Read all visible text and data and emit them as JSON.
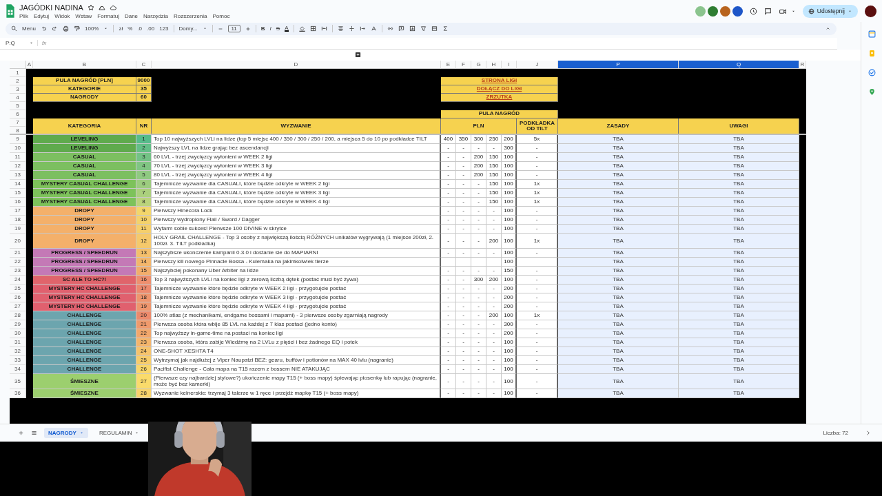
{
  "header": {
    "title": "JAGÓDKI NADINA",
    "menus": [
      "Plik",
      "Edytuj",
      "Widok",
      "Wstaw",
      "Formatuj",
      "Dane",
      "Narzędzia",
      "Rozszerzenia",
      "Pomoc"
    ],
    "share_button": "Udostępnij"
  },
  "collaborators": [
    {
      "color": "#8bc48e"
    },
    {
      "color": "#2e7d32"
    },
    {
      "color": "#b8641e"
    },
    {
      "color": "#1e56c8"
    }
  ],
  "toolbar": {
    "menu": "Menu",
    "zoom": "100%",
    "currency": "zł",
    "percent": "%",
    "decimal_decrease": ".0",
    "decimal_increase": ".00",
    "number_format": "123",
    "font": "Domy...",
    "font_size": "11",
    "bold": "B",
    "italic": "I",
    "strikethrough": "S",
    "text_color": "A"
  },
  "formula_bar": {
    "name_box": "P:Q",
    "fx": "fx"
  },
  "columns": [
    {
      "letter": "A",
      "selected": false
    },
    {
      "letter": "B",
      "selected": false
    },
    {
      "letter": "C",
      "selected": false
    },
    {
      "letter": "D",
      "selected": false
    },
    {
      "letter": "E",
      "selected": false
    },
    {
      "letter": "F",
      "selected": false
    },
    {
      "letter": "G",
      "selected": false
    },
    {
      "letter": "H",
      "selected": false
    },
    {
      "letter": "I",
      "selected": false
    },
    {
      "letter": "J",
      "selected": false
    },
    {
      "letter": "P",
      "selected": true
    },
    {
      "letter": "Q",
      "selected": true
    },
    {
      "letter": "R",
      "selected": false
    }
  ],
  "top_row_numbers": [
    "1",
    "2",
    "3",
    "4",
    "5",
    "6",
    "7",
    "8"
  ],
  "summary": [
    {
      "label": "PULA NAGRÓD [PLN]",
      "value": "9000"
    },
    {
      "label": "KATEGORIE",
      "value": "35"
    },
    {
      "label": "NAGRODY",
      "value": "60"
    }
  ],
  "links": [
    "STRONA LIGI",
    "DOŁĄCZ DO LIGI",
    "ZRZUTKA"
  ],
  "prize_pool": "PULA NAGRÓD",
  "headers": {
    "category": "KATEGORIA",
    "nr": "NR",
    "challenge": "WYZWANIE",
    "pln": "PLN",
    "tilt": "PODKŁADKA OD TILT",
    "rules": "ZASADY",
    "notes": "UWAGI"
  },
  "rows": [
    {
      "row": "9",
      "category": {
        "label": "LEVELING",
        "color": "#5faa4d"
      },
      "nr": {
        "label": "1",
        "color": "#57bb8a"
      },
      "challenge": "Top 10 najwyższych LVLi na lidze (top 5 miejsc 400 / 350 / 300 / 250 / 200, a miejsca 5 do 10 po podkładce TILT",
      "prizes": {
        "E": "400",
        "F": "350",
        "G": "300",
        "H": "250",
        "I": "200"
      },
      "tilt": "5x",
      "rules": "TBA",
      "notes": "TBA"
    },
    {
      "row": "10",
      "category": {
        "label": "LEVELING",
        "color": "#5faa4d"
      },
      "nr": {
        "label": "2",
        "color": "#63be87"
      },
      "challenge": "Najwyższy LVL na lidze grając bez ascendancji",
      "prizes": {
        "E": "-",
        "F": "-",
        "G": "-",
        "H": "-",
        "I": "300"
      },
      "tilt": "-",
      "rules": "TBA",
      "notes": "TBA"
    },
    {
      "row": "11",
      "category": {
        "label": "CASUAL",
        "color": "#7cbf60"
      },
      "nr": {
        "label": "3",
        "color": "#73c285"
      },
      "challenge": "60 LVL - trzej zwycięzcy wyłonieni w WEEK 2 ligi",
      "prizes": {
        "E": "-",
        "F": "-",
        "G": "200",
        "H": "150",
        "I": "100"
      },
      "tilt": "-",
      "rules": "TBA",
      "notes": "TBA"
    },
    {
      "row": "12",
      "category": {
        "label": "CASUAL",
        "color": "#7cbf60"
      },
      "nr": {
        "label": "4",
        "color": "#80c583"
      },
      "challenge": "70 LVL - trzej zwycięzcy wyłonieni w WEEK 3 ligi",
      "prizes": {
        "E": "-",
        "F": "-",
        "G": "200",
        "H": "150",
        "I": "100"
      },
      "tilt": "-",
      "rules": "TBA",
      "notes": "TBA"
    },
    {
      "row": "13",
      "category": {
        "label": "CASUAL",
        "color": "#7cbf60"
      },
      "nr": {
        "label": "5",
        "color": "#8fc981"
      },
      "challenge": "80 LVL - trzej zwycięzcy wyłonieni w WEEK 4 ligi",
      "prizes": {
        "E": "-",
        "F": "-",
        "G": "200",
        "H": "150",
        "I": "100"
      },
      "tilt": "-",
      "rules": "TBA",
      "notes": "TBA"
    },
    {
      "row": "14",
      "category": {
        "label": "MYSTERY CASUAL CHALLENGE",
        "color": "#7dc25a"
      },
      "nr": {
        "label": "6",
        "color": "#9ccc7f"
      },
      "challenge": "Tajemnicze wyzwanie dla CASUALI, które będzie odkryte w WEEK 2 ligi",
      "prizes": {
        "E": "-",
        "F": "-",
        "G": "-",
        "H": "150",
        "I": "100"
      },
      "tilt": "1x",
      "rules": "TBA",
      "notes": "TBA"
    },
    {
      "row": "15",
      "category": {
        "label": "MYSTERY CASUAL CHALLENGE",
        "color": "#7dc25a"
      },
      "nr": {
        "label": "7",
        "color": "#abd07d"
      },
      "challenge": "Tajemnicze wyzwanie dla CASUALI, które będzie odkryte w WEEK 3 ligi",
      "prizes": {
        "E": "-",
        "F": "-",
        "G": "-",
        "H": "150",
        "I": "100"
      },
      "tilt": "1x",
      "rules": "TBA",
      "notes": "TBA"
    },
    {
      "row": "16",
      "category": {
        "label": "MYSTERY CASUAL CHALLENGE",
        "color": "#7dc25a"
      },
      "nr": {
        "label": "8",
        "color": "#bad37b"
      },
      "challenge": "Tajemnicze wyzwanie dla CASUALI, które będzie odkryte w WEEK 4 ligi",
      "prizes": {
        "E": "-",
        "F": "-",
        "G": "-",
        "H": "150",
        "I": "100"
      },
      "tilt": "1x",
      "rules": "TBA",
      "notes": "TBA"
    },
    {
      "row": "17",
      "category": {
        "label": "DROPY",
        "color": "#f4b06a"
      },
      "nr": {
        "label": "9",
        "color": "#f3d66b"
      },
      "challenge": "Pierwszy Hinecora Lock",
      "prizes": {
        "E": "-",
        "F": "-",
        "G": "-",
        "H": "-",
        "I": "100"
      },
      "tilt": "-",
      "rules": "TBA",
      "notes": "TBA"
    },
    {
      "row": "18",
      "category": {
        "label": "DROPY",
        "color": "#f4b06a"
      },
      "nr": {
        "label": "10",
        "color": "#f4d26b"
      },
      "challenge": "Pierwszy wydropiony Flail / Sword / Dagger",
      "prizes": {
        "E": "-",
        "F": "-",
        "G": "-",
        "H": "-",
        "I": "100"
      },
      "tilt": "-",
      "rules": "TBA",
      "notes": "TBA"
    },
    {
      "row": "19",
      "category": {
        "label": "DROPY",
        "color": "#f4b06a"
      },
      "nr": {
        "label": "11",
        "color": "#f5cf6b"
      },
      "challenge": "Wyfarm sobie sukces! Pierwsze 100 DIVINE w skrytce",
      "prizes": {
        "E": "-",
        "F": "-",
        "G": "-",
        "H": "-",
        "I": "100"
      },
      "tilt": "-",
      "rules": "TBA",
      "notes": "TBA"
    },
    {
      "row": "20",
      "category": {
        "label": "DROPY",
        "color": "#f4b06a"
      },
      "nr": {
        "label": "12",
        "color": "#f5c96b"
      },
      "challenge": "HOLY GRAIL CHALLENGE - Top 3 osoby z największą ilością RÓŻNYCH unikatów wygrywają (1 miejsce 200zł, 2. 100zł. 3. TILT podkładka)",
      "prizes": {
        "E": "-",
        "F": "-",
        "G": "-",
        "H": "200",
        "I": "100"
      },
      "tilt": "1x",
      "rules": "TBA",
      "notes": "TBA"
    },
    {
      "row": "21",
      "category": {
        "label": "PROGRESS / SPEEDRUN",
        "color": "#c479b6"
      },
      "nr": {
        "label": "13",
        "color": "#f4bf6b"
      },
      "challenge": "Najszybsze ukonczenie kampanii 0.3.0 i dostanie sie do MAPIARNI",
      "prizes": {
        "E": "-",
        "F": "-",
        "G": "-",
        "H": "-",
        "I": "100"
      },
      "tilt": "-",
      "rules": "TBA",
      "notes": "TBA"
    },
    {
      "row": "22",
      "category": {
        "label": "PROGRESS / SPEEDRUN",
        "color": "#c479b6"
      },
      "nr": {
        "label": "14",
        "color": "#f3b66b"
      },
      "challenge": "Pierwszy kill nowego Pinnacle Bossa - Kulemaka na jakimkolwiek tierze",
      "prizes": {
        "I": "100"
      },
      "rules": "TBA",
      "notes": "TBA"
    },
    {
      "row": "23",
      "category": {
        "label": "PROGRESS / SPEEDRUN",
        "color": "#c479b6"
      },
      "nr": {
        "label": "15",
        "color": "#f2ad6b"
      },
      "challenge": "Najszybciej pokonany Uber Arbiter na lidze",
      "prizes": {
        "E": "-",
        "F": "-",
        "G": "-",
        "H": "-",
        "I": "150"
      },
      "tilt": "-",
      "rules": "TBA",
      "notes": "TBA"
    },
    {
      "row": "24",
      "category": {
        "label": "SC ALE TO HC?!",
        "color": "#e0646b"
      },
      "nr": {
        "label": "16",
        "color": "#ee8f6e"
      },
      "challenge": "Top 3 najwyższych LVLi na koniec ligi z zerową liczbą dętek (postać musi być żywa)",
      "prizes": {
        "E": "-",
        "F": "-",
        "G": "300",
        "H": "200",
        "I": "100"
      },
      "tilt": "-",
      "rules": "TBA",
      "notes": "TBA"
    },
    {
      "row": "25",
      "category": {
        "label": "MYSTERY HC CHALLENGE",
        "color": "#e0606e"
      },
      "nr": {
        "label": "17",
        "color": "#ed8a6e"
      },
      "challenge": "Tajemnicze wyzwanie które będzie odkryte w WEEK 2 ligi - przygotujcie postać",
      "prizes": {
        "E": "-",
        "F": "-",
        "G": "-",
        "H": "-",
        "I": "200"
      },
      "tilt": "-",
      "rules": "TBA",
      "notes": "TBA"
    },
    {
      "row": "26",
      "category": {
        "label": "MYSTERY HC CHALLENGE",
        "color": "#e0606e"
      },
      "nr": {
        "label": "18",
        "color": "#ef956d"
      },
      "challenge": "Tajemnicze wyzwanie które będzie odkryte w WEEK 3 ligi - przygotujcie postać",
      "prizes": {
        "E": "-",
        "F": "-",
        "G": "-",
        "H": "-",
        "I": "200"
      },
      "tilt": "-",
      "rules": "TBA",
      "notes": "TBA"
    },
    {
      "row": "27",
      "category": {
        "label": "MYSTERY HC CHALLENGE",
        "color": "#e0606e"
      },
      "nr": {
        "label": "19",
        "color": "#ef966d"
      },
      "challenge": "Tajemnicze wyzwanie które będzie odkryte w WEEK 4 ligi - przygotujcie postać",
      "prizes": {
        "E": "-",
        "F": "-",
        "G": "-",
        "H": "-",
        "I": "200"
      },
      "tilt": "-",
      "rules": "TBA",
      "notes": "TBA"
    },
    {
      "row": "28",
      "category": {
        "label": "CHALLENGE",
        "color": "#6ca5ae"
      },
      "nr": {
        "label": "20",
        "color": "#ed8a6c"
      },
      "challenge": "100% atlas (z mechanikami, endgame bossami i mapami) - 3 pierwsze osoby zgarniają nagrody",
      "prizes": {
        "E": "-",
        "F": "-",
        "G": "-",
        "H": "200",
        "I": "100"
      },
      "tilt": "1x",
      "rules": "TBA",
      "notes": "TBA"
    },
    {
      "row": "29",
      "category": {
        "label": "CHALLENGE",
        "color": "#6ca5ae"
      },
      "nr": {
        "label": "21",
        "color": "#ef9a6c"
      },
      "challenge": "Pierwsza osoba która wbije 85 LVL na każdej z 7 klas postaci (jedno konto)",
      "prizes": {
        "E": "-",
        "F": "-",
        "G": "-",
        "H": "-",
        "I": "300"
      },
      "tilt": "-",
      "rules": "TBA",
      "notes": "TBA"
    },
    {
      "row": "30",
      "category": {
        "label": "CHALLENGE",
        "color": "#6ca5ae"
      },
      "nr": {
        "label": "22",
        "color": "#f2a76b"
      },
      "challenge": "Top najwyższy in-game-time na postaci na koniec ligi",
      "prizes": {
        "E": "-",
        "F": "-",
        "G": "-",
        "H": "-",
        "I": "200"
      },
      "tilt": "-",
      "rules": "TBA",
      "notes": "TBA"
    },
    {
      "row": "31",
      "category": {
        "label": "CHALLENGE",
        "color": "#6ca5ae"
      },
      "nr": {
        "label": "23",
        "color": "#f4b56b"
      },
      "challenge": "Pierwsza osoba, która zabije Wiedźmę na 2 LVLu z pięści i bez żadnego EQ i potek",
      "prizes": {
        "E": "-",
        "F": "-",
        "G": "-",
        "H": "-",
        "I": "100"
      },
      "tilt": "-",
      "rules": "TBA",
      "notes": "TBA"
    },
    {
      "row": "32",
      "category": {
        "label": "CHALLENGE",
        "color": "#6ca5ae"
      },
      "nr": {
        "label": "24",
        "color": "#f6c36b"
      },
      "challenge": "ONE-SHOT XESHTA T4",
      "prizes": {
        "E": "-",
        "F": "-",
        "G": "-",
        "H": "-",
        "I": "100"
      },
      "tilt": "-",
      "rules": "TBA",
      "notes": "TBA"
    },
    {
      "row": "33",
      "category": {
        "label": "CHALLENGE",
        "color": "#6ca5ae"
      },
      "nr": {
        "label": "25",
        "color": "#f7cd6b"
      },
      "challenge": "Wytrzymaj jak najdłużej z Viper Naupatzi BEZ: gearu, buffów i potionów na MAX 40 lvlu (nagranie)",
      "prizes": {
        "E": "-",
        "F": "-",
        "G": "-",
        "H": "-",
        "I": "100"
      },
      "tilt": "-",
      "rules": "TBA",
      "notes": "TBA"
    },
    {
      "row": "34",
      "category": {
        "label": "CHALLENGE",
        "color": "#6ca5ae"
      },
      "nr": {
        "label": "26",
        "color": "#f9d76b"
      },
      "challenge": "Pacifist Challenge - Cała mapa na T15 razem z bossem NIE ATAKUJĄC",
      "prizes": {
        "E": "-",
        "F": "-",
        "G": "-",
        "H": "-",
        "I": "100"
      },
      "tilt": "-",
      "rules": "TBA",
      "notes": "TBA"
    },
    {
      "row": "35",
      "category": {
        "label": "ŚMIESZNE",
        "color": "#9ccf6e"
      },
      "nr": {
        "label": "27",
        "color": "#fadb6b"
      },
      "challenge": "(Pierwsze czy najbardziej stylowe?) ukończenie mapy T15 (+ boss mapy) śpiewając piosenkę lub rapując (nagranie, może być bez kamerki)",
      "prizes": {
        "E": "-",
        "F": "-",
        "G": "-",
        "H": "-",
        "I": "100"
      },
      "tilt": "-",
      "rules": "TBA",
      "notes": "TBA"
    },
    {
      "row": "36",
      "category": {
        "label": "ŚMIESZNE",
        "color": "#9ccf6e"
      },
      "nr": {
        "label": "28",
        "color": "#f8d46b"
      },
      "challenge": "Wyzwanie kelnerskie: trzymaj 3 talerze w 1 ręce i przejdź mapkę T15 (+ boss mapy)",
      "prizes": {
        "E": "-",
        "F": "-",
        "G": "-",
        "H": "-",
        "I": "100"
      },
      "tilt": "-",
      "rules": "TBA",
      "notes": "TBA"
    }
  ],
  "sheet_tabs": [
    {
      "label": "NAGRODY",
      "selected": true
    },
    {
      "label": "REGULAMIN",
      "selected": false
    }
  ],
  "status": "Liczba: 72"
}
